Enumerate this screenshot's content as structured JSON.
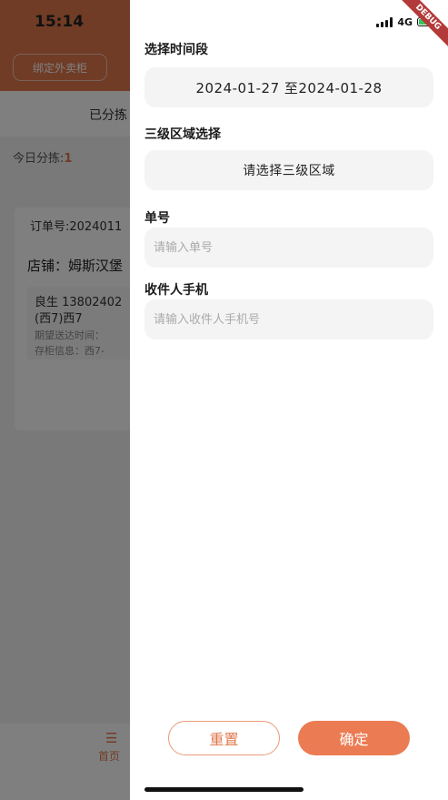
{
  "status_bar": {
    "time": "15:14",
    "network": "4G"
  },
  "debug_banner": "DEBUG",
  "background_page": {
    "bind_button_label": "绑定外卖柜",
    "tab_label": "已分拣",
    "today_label": "今日分拣:",
    "today_count": "1",
    "order_no": "订单号:2024011",
    "store": "店铺：姆斯汉堡",
    "recipient_line": "良生 13802402",
    "address_line": "(西7)西7",
    "expected_time_label": "期望送达时间：",
    "cabinet_label": "存柜信息：西7-",
    "nav_home_label": "首页"
  },
  "filter_drawer": {
    "time_range": {
      "label": "选择时间段",
      "value": "2024-01-27 至2024-01-28"
    },
    "region": {
      "label": "三级区域选择",
      "value": "请选择三级区域"
    },
    "order_number": {
      "label": "单号",
      "placeholder": "请输入单号"
    },
    "recipient_phone": {
      "label": "收件人手机",
      "placeholder": "请输入收件人手机号"
    },
    "reset_label": "重置",
    "confirm_label": "确定"
  },
  "colors": {
    "accent": "#eb7b52",
    "header": "#e0794c",
    "field_bg": "#f4f4f4"
  }
}
